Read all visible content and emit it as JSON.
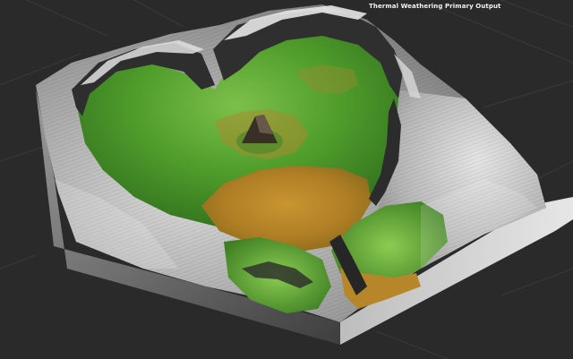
{
  "viewport": {
    "title": "Thermal Weathering Primary Output"
  },
  "colors": {
    "background": "#2a2a2a",
    "grid_line": "#3a3a3a",
    "lowland": "#b8862a",
    "vegetation": "#5aa832",
    "rock": "#a6a6a6",
    "cliff": "#3b3b3b"
  }
}
